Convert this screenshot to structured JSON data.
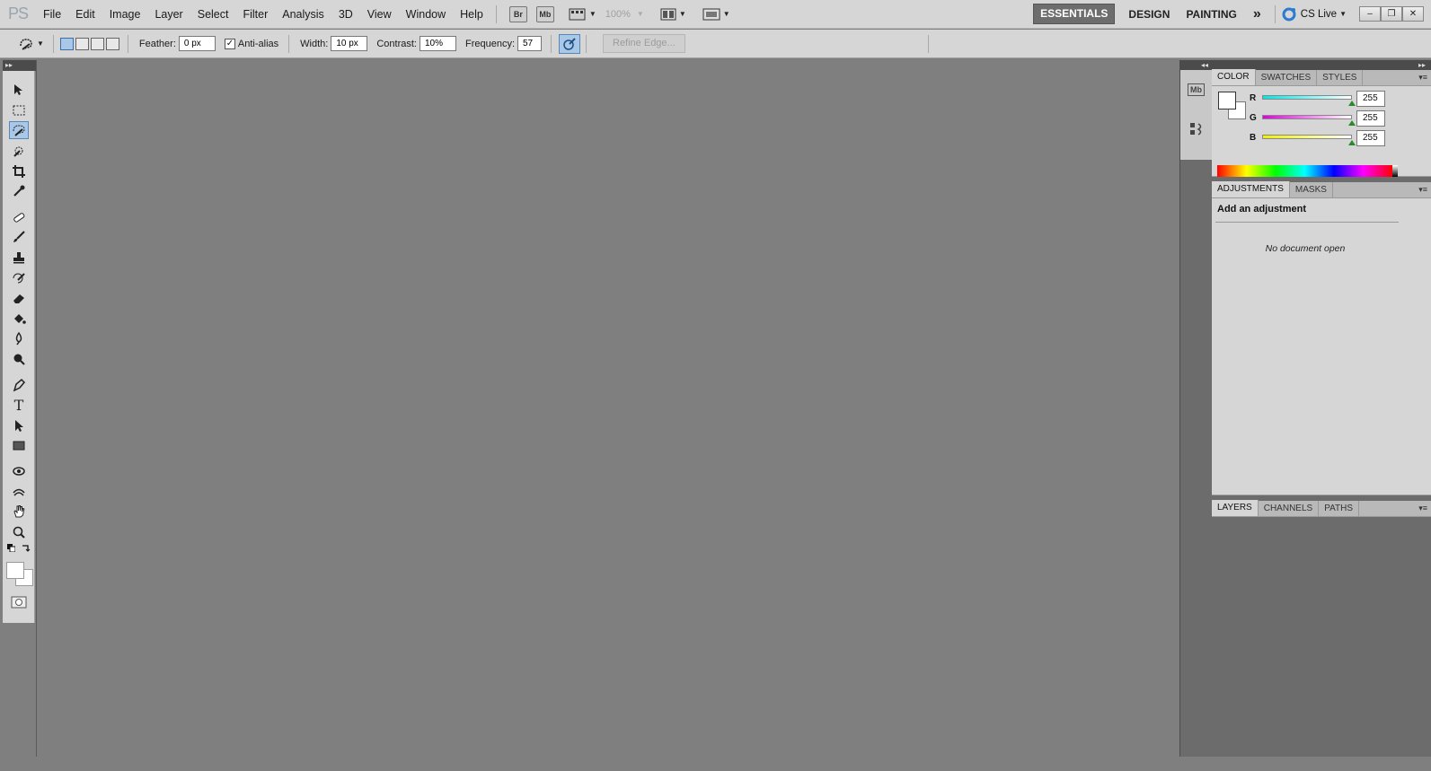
{
  "app": {
    "logo": "PS"
  },
  "menu": [
    "File",
    "Edit",
    "Image",
    "Layer",
    "Select",
    "Filter",
    "Analysis",
    "3D",
    "View",
    "Window",
    "Help"
  ],
  "app_bar": {
    "bridge": "Br",
    "mini_bridge": "Mb",
    "zoom": "100%"
  },
  "workspaces": {
    "essentials": "ESSENTIALS",
    "design": "DESIGN",
    "painting": "PAINTING",
    "more": "»"
  },
  "cs_live": "CS Live",
  "window_controls": {
    "minimize": "–",
    "restore": "❐",
    "close": "✕"
  },
  "options": {
    "feather_label": "Feather:",
    "feather_value": "0 px",
    "anti_alias_label": "Anti-alias",
    "anti_alias_checked": "✓",
    "width_label": "Width:",
    "width_value": "10 px",
    "contrast_label": "Contrast:",
    "contrast_value": "10%",
    "frequency_label": "Frequency:",
    "frequency_value": "57",
    "refine_edge": "Refine Edge..."
  },
  "toolbox": {
    "collapse": "▸▸"
  },
  "dock": {
    "collapse": "◂◂",
    "expand": "▸▸",
    "mini_bridge": "Mb"
  },
  "color_panel": {
    "tabs": [
      "COLOR",
      "SWATCHES",
      "STYLES"
    ],
    "channels": [
      {
        "label": "R",
        "value": "255",
        "level": 1.0,
        "color": "#00e5e5"
      },
      {
        "label": "G",
        "value": "255",
        "level": 1.0,
        "color": "#e000e0"
      },
      {
        "label": "B",
        "value": "255",
        "level": 1.0,
        "color": "#f0f000"
      }
    ]
  },
  "adjustments_panel": {
    "tabs": [
      "ADJUSTMENTS",
      "MASKS"
    ],
    "title": "Add an adjustment",
    "empty": "No document open"
  },
  "layers_panel": {
    "tabs": [
      "LAYERS",
      "CHANNELS",
      "PATHS"
    ]
  },
  "panel_menu_icon": "▾≡"
}
